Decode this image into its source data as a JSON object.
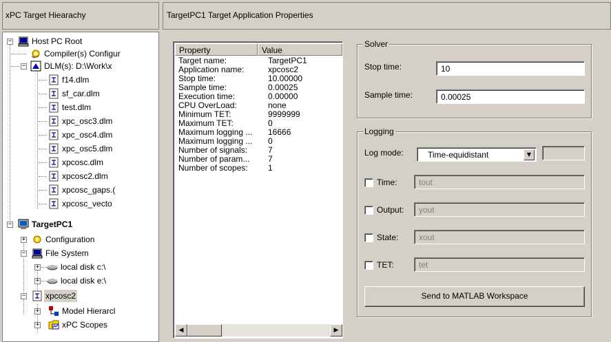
{
  "left_pane": {
    "header": "xPC Target Hiearachy",
    "tree": [
      {
        "label": "Host PC Root",
        "icon": "host-pc-icon",
        "bold": false
      },
      {
        "label": "Compiler(s) Configur",
        "icon": "compiler-config-icon",
        "bold": false
      },
      {
        "label": "DLM(s): D:\\Work\\x",
        "icon": "dlm-folder-icon",
        "bold": false
      },
      {
        "label": "f14.dlm",
        "icon": "dlm-file-icon",
        "bold": false
      },
      {
        "label": "sf_car.dlm",
        "icon": "dlm-file-icon",
        "bold": false
      },
      {
        "label": "test.dlm",
        "icon": "dlm-file-icon",
        "bold": false
      },
      {
        "label": "xpc_osc3.dlm",
        "icon": "dlm-file-icon",
        "bold": false
      },
      {
        "label": "xpc_osc4.dlm",
        "icon": "dlm-file-icon",
        "bold": false
      },
      {
        "label": "xpc_osc5.dlm",
        "icon": "dlm-file-icon",
        "bold": false
      },
      {
        "label": "xpcosc.dlm",
        "icon": "dlm-file-icon",
        "bold": false
      },
      {
        "label": "xpcosc2.dlm",
        "icon": "dlm-file-icon",
        "bold": false
      },
      {
        "label": "xpcosc_gaps.(",
        "icon": "dlm-file-icon",
        "bold": false
      },
      {
        "label": "xpcosc_vecto",
        "icon": "dlm-file-icon",
        "bold": false
      },
      {
        "label": "TargetPC1",
        "icon": "target-pc-icon",
        "bold": true
      },
      {
        "label": "Configuration",
        "icon": "configuration-icon",
        "bold": false
      },
      {
        "label": "File System",
        "icon": "file-system-icon",
        "bold": false
      },
      {
        "label": "local disk c:\\",
        "icon": "local-disk-icon",
        "bold": false
      },
      {
        "label": "local disk e:\\",
        "icon": "local-disk-icon",
        "bold": false
      },
      {
        "label": "xpcosc2",
        "icon": "application-icon",
        "bold": false
      },
      {
        "label": "Model Hierarcl",
        "icon": "model-hierarchy-icon",
        "bold": false
      },
      {
        "label": "xPC Scopes",
        "icon": "scopes-icon",
        "bold": false
      }
    ]
  },
  "right_pane": {
    "header": "TargetPC1 Target Application Properties",
    "property_list": {
      "columns": [
        "Property",
        "Value"
      ],
      "rows": [
        [
          "Target name:",
          "TargetPC1"
        ],
        [
          "Application name:",
          "xpcosc2"
        ],
        [
          "Stop time:",
          "10.00000"
        ],
        [
          "Sample time:",
          "0.00025"
        ],
        [
          "Execution time:",
          "0.00000"
        ],
        [
          "CPU OverLoad:",
          "none"
        ],
        [
          "Minimum TET:",
          "9999999"
        ],
        [
          "Maximum TET:",
          "0"
        ],
        [
          "Maximum logging ...",
          "16666"
        ],
        [
          "Maximum logging ...",
          "0"
        ],
        [
          "Number of signals:",
          "7"
        ],
        [
          "Number of param...",
          "7"
        ],
        [
          "Number of scopes:",
          "1"
        ]
      ]
    },
    "solver": {
      "title": "Solver",
      "stop_time_label": "Stop time:",
      "stop_time_value": "10",
      "sample_time_label": "Sample time:",
      "sample_time_value": "0.00025"
    },
    "logging": {
      "title": "Logging",
      "log_mode_label": "Log mode:",
      "log_mode_value": "Time-equidistant",
      "log_mode_extra": "",
      "time_label": "Time:",
      "time_value": "tout",
      "output_label": "Output:",
      "output_value": "yout",
      "state_label": "State:",
      "state_value": "xout",
      "tet_label": "TET:",
      "tet_value": "tet",
      "send_button": "Send to MATLAB Workspace"
    }
  }
}
